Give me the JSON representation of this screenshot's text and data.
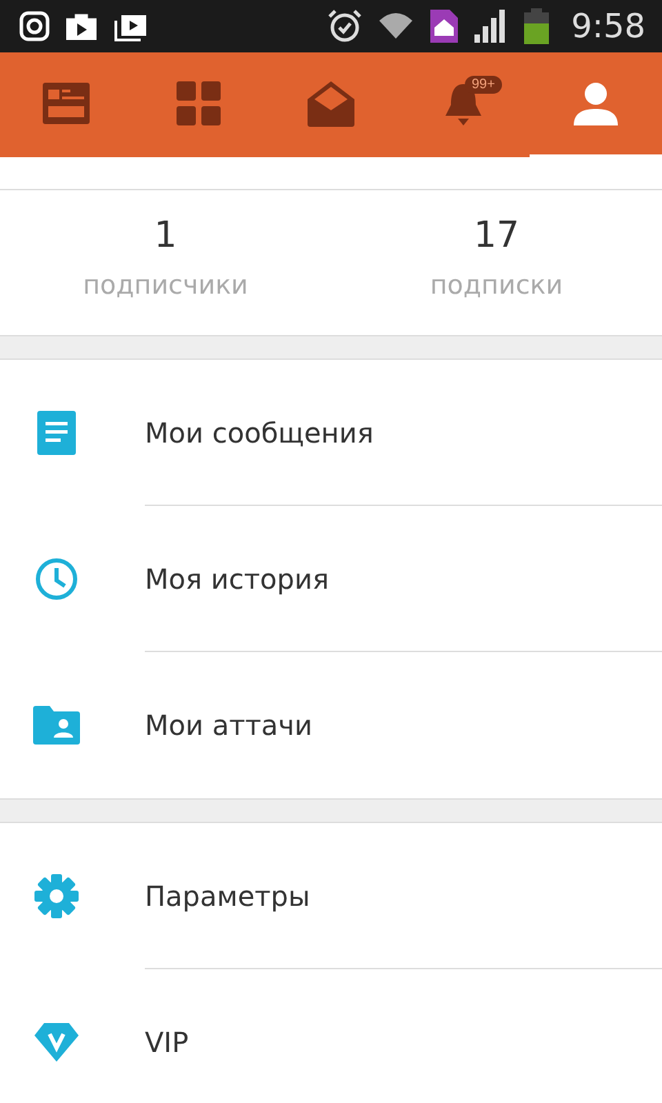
{
  "status_bar": {
    "time": "9:58"
  },
  "tabs": [
    {
      "selected": false
    },
    {
      "selected": false
    },
    {
      "selected": false
    },
    {
      "selected": false,
      "badge": "99+"
    },
    {
      "selected": true
    }
  ],
  "stats": [
    {
      "value": "1",
      "label": "подписчики"
    },
    {
      "value": "17",
      "label": "подписки"
    }
  ],
  "menu_sections": [
    [
      {
        "label": "Мои сообщения"
      },
      {
        "label": "Моя история"
      },
      {
        "label": "Мои аттачи"
      }
    ],
    [
      {
        "label": "Параметры"
      },
      {
        "label": "VIP"
      }
    ]
  ]
}
